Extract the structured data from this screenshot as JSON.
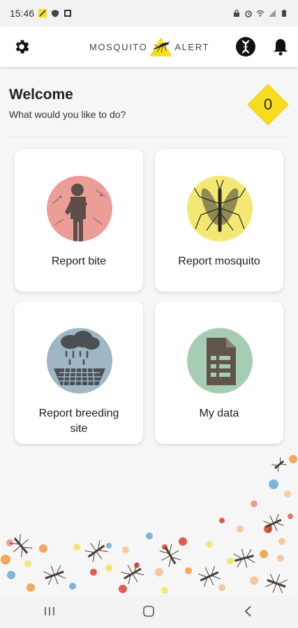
{
  "status_bar": {
    "time": "15:46"
  },
  "app": {
    "logo_left": "MOSQUITO",
    "logo_right": "ALERT",
    "accent_color": "#f7de1c"
  },
  "welcome": {
    "title": "Welcome",
    "subtitle": "What would you like to do?",
    "score": "0"
  },
  "cards": [
    {
      "label": "Report bite",
      "icon": "person-bite-icon",
      "circle_color": "#ec9d98"
    },
    {
      "label": "Report mosquito",
      "icon": "mosquito-icon",
      "circle_color": "#f3e874"
    },
    {
      "label_line1": "Report breeding",
      "label_line2": "site",
      "icon": "breeding-site-icon",
      "circle_color": "#9fb6c4"
    },
    {
      "label": "My data",
      "icon": "document-list-icon",
      "circle_color": "#a6cdb3"
    }
  ],
  "navigation": {
    "recent_apps": "recent-apps-icon",
    "home": "home-icon",
    "back": "back-icon"
  }
}
